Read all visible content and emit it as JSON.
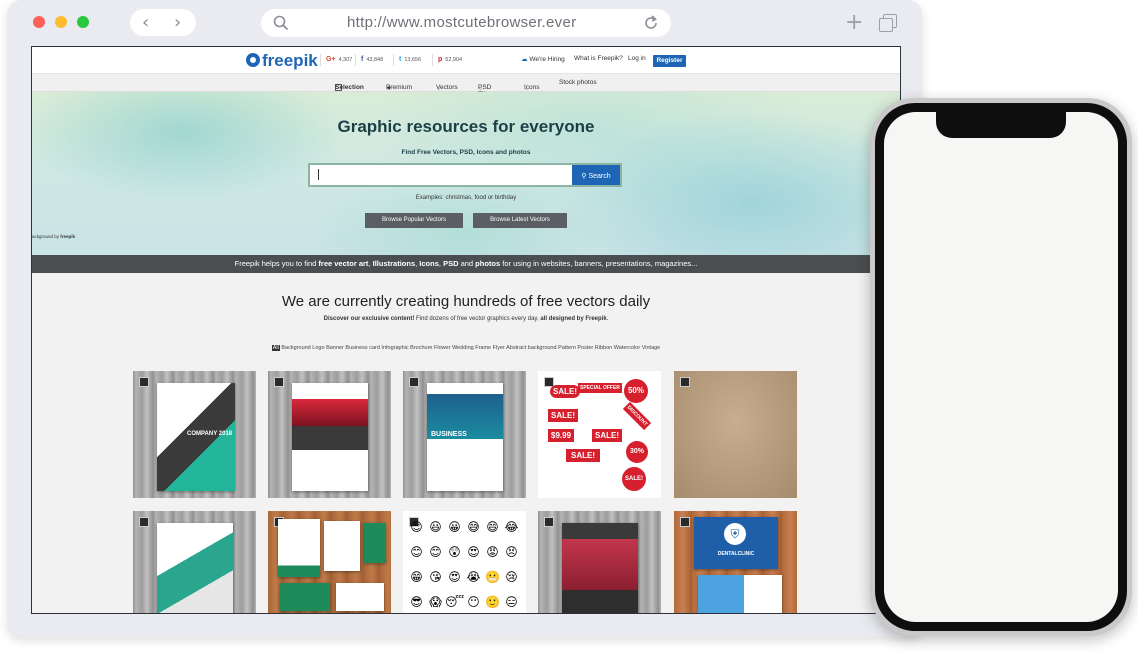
{
  "browser": {
    "url": "http://www.mostcutebrowser.ever",
    "back_glyph": "‹",
    "forward_glyph": "›",
    "new_tab_glyph": "+",
    "traffic_colors": {
      "close": "#fe5f57",
      "minimize": "#febc2e",
      "maximize": "#28c840"
    }
  },
  "site": {
    "logo": "freepik",
    "social": [
      {
        "icon": "G+",
        "count": "4,307",
        "color": "#dd4b39"
      },
      {
        "icon": "f",
        "count": "43,848",
        "color": "#3b5998"
      },
      {
        "icon": "t",
        "count": "13,656",
        "color": "#1da1f2"
      },
      {
        "icon": "p",
        "count": "52,904",
        "color": "#cb2027"
      }
    ],
    "top_links": {
      "hiring": "We're Hiring",
      "what": "What is Freepik?",
      "login": "Log in",
      "register": "Register"
    },
    "menu": {
      "selection": "Selection",
      "premium": "Premium",
      "vectors": "Vectors",
      "psd": "PSD Files",
      "icons": "Icons",
      "stock": "Stock photos"
    },
    "hero": {
      "title": "Graphic resources for everyone",
      "subtitle": "Find Free Vectors, PSD, Icons and photos",
      "search_value": "",
      "search_button": "Search",
      "examples_prefix": "Examples: ",
      "example_1": "christmas",
      "example_sep1": ", ",
      "example_2": "food",
      "example_sep2": " or ",
      "example_3": "birthday",
      "btn_popular": "Browse Popular Vectors",
      "btn_latest": "Browse Latest Vectors",
      "credit_prefix": "ackground by ",
      "credit_name": "freepik"
    },
    "strip": {
      "pre": "Freepik helps you to find ",
      "b1": "free vector art",
      "s1": ", ",
      "b2": "Illustrations",
      "s2": ", ",
      "b3": "Icons",
      "s3": ", ",
      "b4": "PSD",
      "s4": " and ",
      "b5": "photos",
      "post": " for using in websites, banners, presentations, magazines..."
    },
    "section": {
      "title": "We are currently creating hundreds of free vectors daily",
      "sub_b1": "Discover our exclusive content!",
      "sub_mid": " Find dozens of free vector graphics every day, ",
      "sub_b2": "all designed by Freepik",
      "sub_end": "."
    },
    "tags": [
      "All",
      "Background",
      "Logo",
      "Banner",
      "Business card",
      "Infographic",
      "Brochure",
      "Flower",
      "Wedding",
      "Frame",
      "Flyer",
      "Abstract background",
      "Pattern",
      "Poster",
      "Ribbon",
      "Watercolor",
      "Vintage"
    ],
    "thumb_text": {
      "company_2018": "COMPANY 2018",
      "business": "BUSINESS",
      "sale": "SALE!",
      "special_offer": "SPECIAL OFFER",
      "fifty_pct": "50%",
      "price": "$9.99",
      "thirty_pct": "30%",
      "discount": "DISCOUNT",
      "dental": "DENTALCLINIC",
      "emojis": [
        "😊",
        "😃",
        "😀",
        "😅",
        "😄",
        "😂",
        "😊",
        "😊",
        "😲",
        "😍",
        "😡",
        "😣",
        "😁",
        "😘",
        "😍",
        "😭",
        "😬",
        "😢",
        "😎",
        "😱",
        "😴",
        "😶",
        "🙂",
        "😑"
      ]
    }
  }
}
